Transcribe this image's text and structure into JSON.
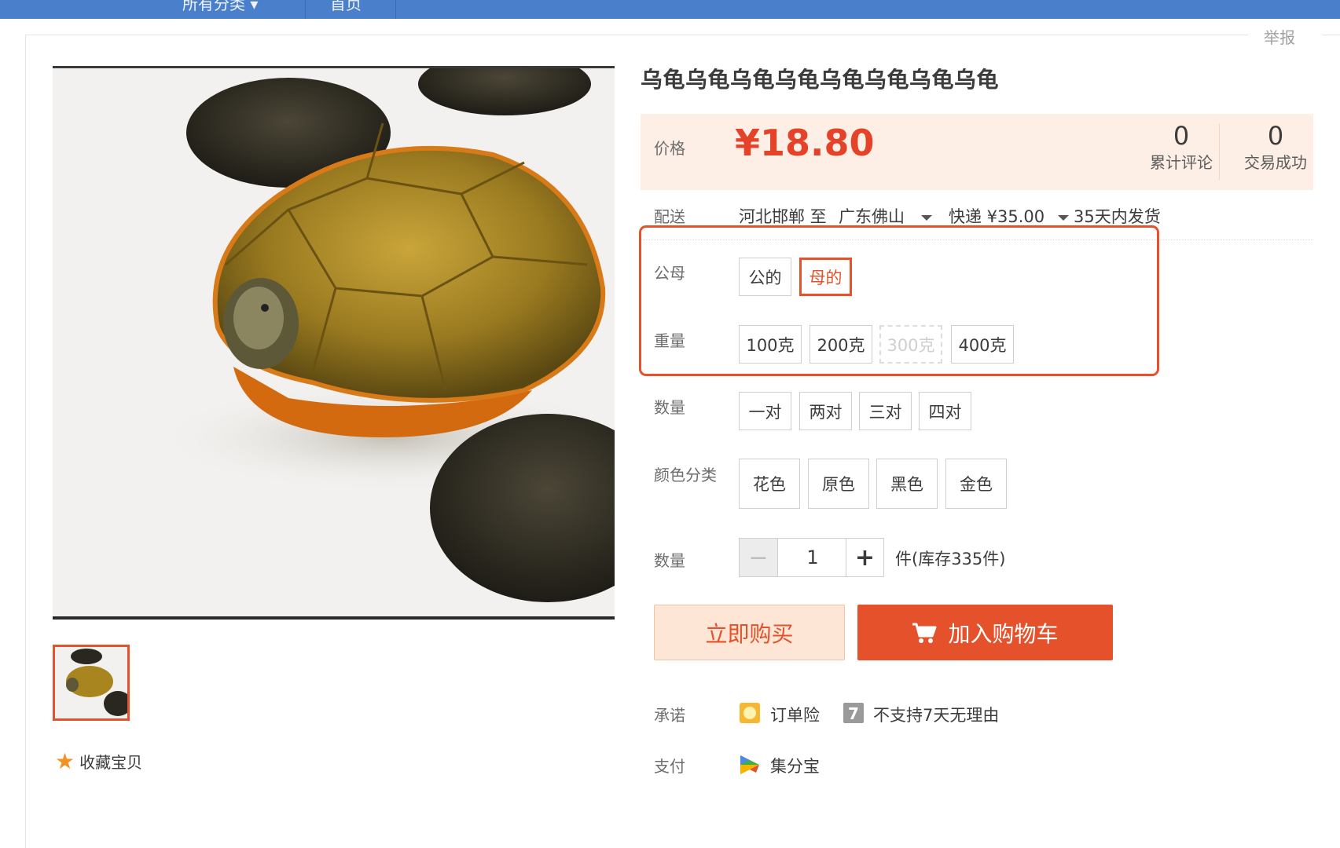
{
  "nav": {
    "category_label": "所有分类 ▾",
    "home_label": "首页"
  },
  "report_label": "举报",
  "favorite_label": "收藏宝贝",
  "product": {
    "title": "乌龟乌龟乌龟乌龟乌龟乌龟乌龟乌龟",
    "price_label": "价格",
    "price": "¥18.80",
    "reviews_count": "0",
    "reviews_label": "累计评论",
    "deals_count": "0",
    "deals_label": "交易成功"
  },
  "shipping": {
    "label": "配送",
    "route": "河北邯郸 至",
    "destination": "广东佛山",
    "express": "快递 ¥35.00",
    "dispatch": "35天内发货"
  },
  "options": {
    "gender": {
      "label": "公母",
      "values": [
        "公的",
        "母的"
      ],
      "selected": "母的"
    },
    "weight": {
      "label": "重量",
      "values": [
        "100克",
        "200克",
        "300克",
        "400克"
      ],
      "disabled": "300克"
    },
    "pairs": {
      "label": "数量",
      "values": [
        "一对",
        "两对",
        "三对",
        "四对"
      ]
    },
    "color": {
      "label": "颜色分类",
      "values": [
        "花色",
        "原色",
        "黑色",
        "金色"
      ]
    }
  },
  "quantity": {
    "label": "数量",
    "minus": "−",
    "value": "1",
    "plus": "+",
    "stock_text": "件(库存335件)"
  },
  "actions": {
    "buy_now": "立即购买",
    "add_to_cart": "加入购物车"
  },
  "promise": {
    "label": "承诺",
    "items": [
      "订单险",
      "不支持7天无理由"
    ]
  },
  "payment": {
    "label": "支付",
    "method": "集分宝"
  },
  "colors": {
    "accent": "#e5512b",
    "nav_bg": "#4a7fcb",
    "price_bg": "#fdefe5"
  }
}
